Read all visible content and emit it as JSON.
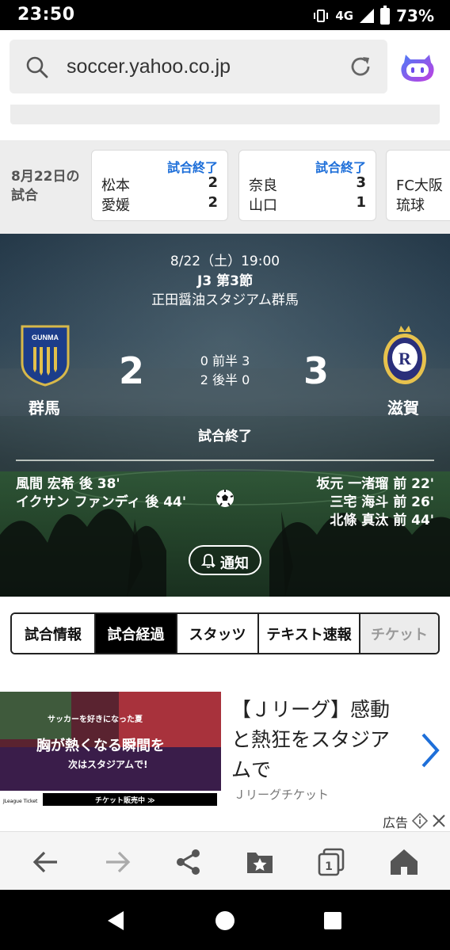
{
  "status_bar": {
    "time": "23:50",
    "network": "4G",
    "battery": "73%",
    "icons": [
      "vibrate-icon",
      "signal-icon",
      "battery-icon"
    ]
  },
  "browser": {
    "url": "soccer.yahoo.co.jp",
    "icons": [
      "search-icon",
      "reload-icon",
      "assistant-icon"
    ]
  },
  "matches_strip": {
    "label": "8月22日の試合",
    "cards": [
      {
        "status": "試合終了",
        "home": "松本",
        "home_score": "2",
        "away": "愛媛",
        "away_score": "2"
      },
      {
        "status": "試合終了",
        "home": "奈良",
        "home_score": "3",
        "away": "山口",
        "away_score": "1"
      },
      {
        "status": "",
        "home": "FC大阪",
        "home_score": "",
        "away": "琉球",
        "away_score": ""
      }
    ]
  },
  "match": {
    "datetime": "8/22（土）19:00",
    "round": "J3 第3節",
    "venue": "正田醤油スタジアム群馬",
    "home_team": "群馬",
    "away_team": "滋賀",
    "home_score": "2",
    "away_score": "3",
    "first_half": "0 前半 3",
    "second_half": "2 後半 0",
    "status": "試合終了",
    "home_emblem_text": "GUNMA",
    "away_emblem_text": "R",
    "home_goals": [
      "風間 宏希 後 38'",
      "イクサン ファンディ 後 44'"
    ],
    "away_goals": [
      "坂元 一渚瑠 前 22'",
      "三宅 海斗 前 26'",
      "北條 真汰 前 44'"
    ],
    "notify_label": "通知"
  },
  "tabs": [
    {
      "label": "試合情報",
      "state": "normal"
    },
    {
      "label": "試合経過",
      "state": "active"
    },
    {
      "label": "スタッツ",
      "state": "normal"
    },
    {
      "label": "テキスト速報",
      "state": "normal"
    },
    {
      "label": "チケット",
      "state": "disabled"
    }
  ],
  "ad": {
    "title": "【Ｊリーグ】感動と熱狂をスタジアムで",
    "sponsor": "Ｊリーグチケット",
    "label": "広告",
    "image_texts": {
      "line1": "サッカーを好きになった夏",
      "line2": "胸が熱くなる瞬間を",
      "line3": "次はスタジアムで!",
      "bottom": "チケット販売中 ≫",
      "logo": "JLeague Ticket"
    }
  },
  "bottom_bar": {
    "icons": [
      "back-icon",
      "forward-icon",
      "share-icon",
      "bookmark-icon",
      "tabs-icon",
      "home-icon"
    ],
    "tab_count": "1"
  },
  "colors": {
    "accent_blue": "#1e6fd9",
    "dark": "#000000"
  }
}
